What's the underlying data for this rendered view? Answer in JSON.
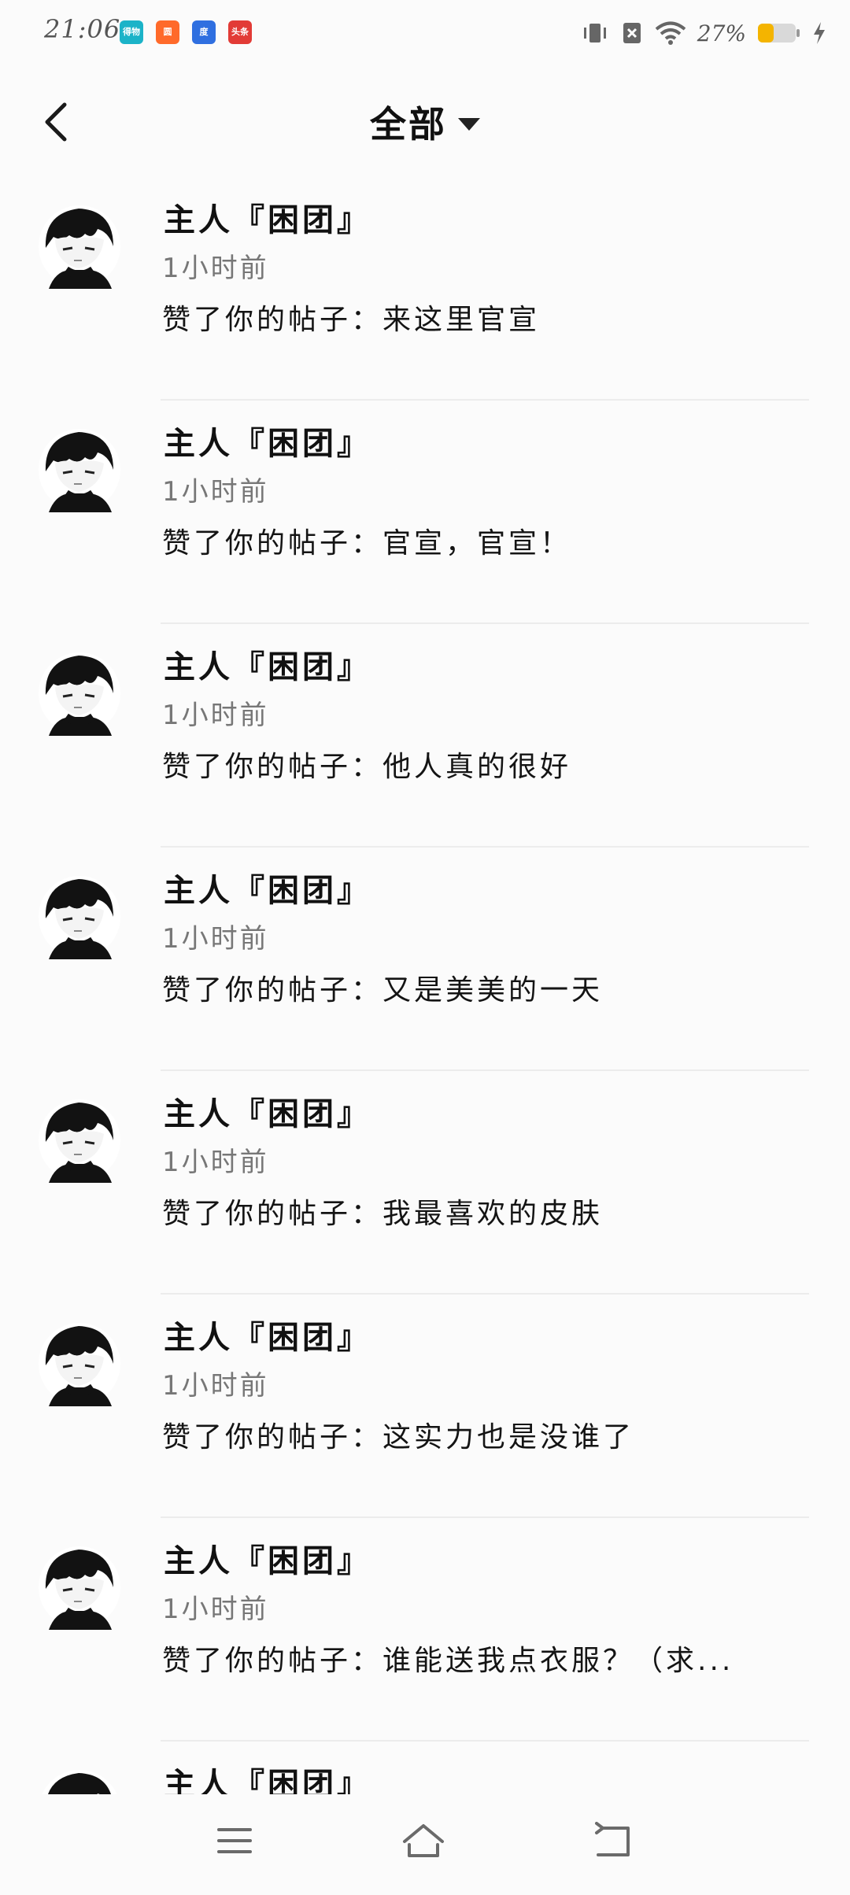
{
  "status_bar": {
    "time": "21:06",
    "app_badges": [
      {
        "icon": "video-app-icon",
        "color": "#1bb3c8",
        "label": "得物"
      },
      {
        "icon": "map-app-icon",
        "color": "#ff6a2a",
        "label": "圆"
      },
      {
        "icon": "baidu-app-icon",
        "color": "#2f6fe0",
        "label": "度"
      },
      {
        "icon": "toutiao-app-icon",
        "color": "#e23b36",
        "label": "头条"
      }
    ],
    "battery_percent": "27%",
    "battery_color": "#f4b400"
  },
  "header": {
    "title": "全部"
  },
  "items": [
    {
      "name": "主人『困团』",
      "time": "1小时前",
      "text": "赞了你的帖子：来这里官宣"
    },
    {
      "name": "主人『困团』",
      "time": "1小时前",
      "text": "赞了你的帖子：官宣，官宣！"
    },
    {
      "name": "主人『困团』",
      "time": "1小时前",
      "text": "赞了你的帖子：他人真的很好"
    },
    {
      "name": "主人『困团』",
      "time": "1小时前",
      "text": "赞了你的帖子：又是美美的一天"
    },
    {
      "name": "主人『困团』",
      "time": "1小时前",
      "text": "赞了你的帖子：我最喜欢的皮肤"
    },
    {
      "name": "主人『困团』",
      "time": "1小时前",
      "text": "赞了你的帖子：这实力也是没谁了"
    },
    {
      "name": "主人『困团』",
      "time": "1小时前",
      "text": "赞了你的帖子：谁能送我点衣服？（求..."
    },
    {
      "name": "主人『困团』",
      "time": "",
      "text": ""
    }
  ],
  "bottom_nav": {
    "menu_icon": "menu-icon",
    "home_icon": "home-icon",
    "back_icon": "return-icon"
  }
}
